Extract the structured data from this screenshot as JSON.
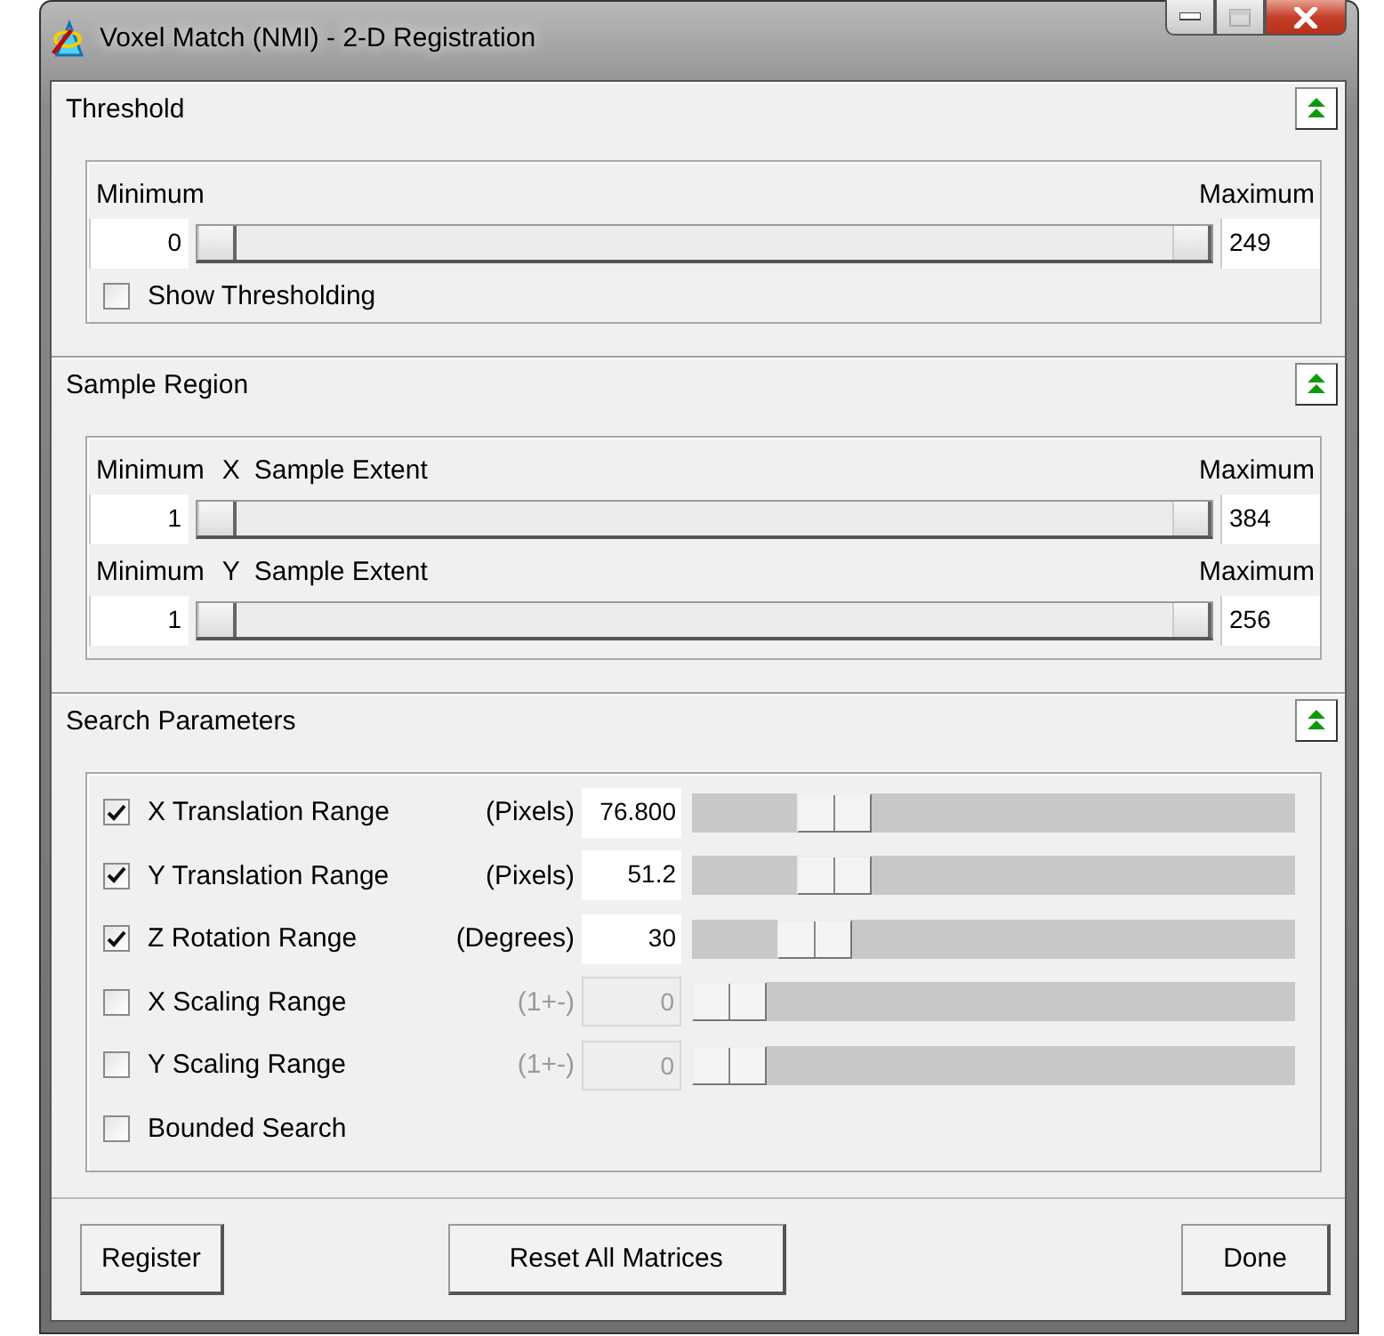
{
  "window": {
    "title": "Voxel Match (NMI) - 2-D Registration"
  },
  "sections": [
    {
      "title": "Threshold",
      "expanded": true,
      "ranges": [
        {
          "min_label": "Minimum",
          "max_label": "Maximum",
          "min_value": "0",
          "max_value": "249",
          "thumbs": [
            {
              "level": 0
            },
            {
              "level": 1
            }
          ]
        }
      ],
      "checkboxes": [
        {
          "label": "Show Thresholding",
          "checked": false
        }
      ]
    },
    {
      "title": "Sample Region",
      "expanded": true,
      "ranges": [
        {
          "min_label": "Minimum",
          "axis": "X",
          "caption": "Sample Extent",
          "max_label": "Maximum",
          "min_value": "1",
          "max_value": "384",
          "thumbs": [
            {
              "level": 0
            },
            {
              "level": 1
            }
          ]
        },
        {
          "min_label": "Minimum",
          "axis": "Y",
          "caption": "Sample Extent",
          "max_label": "Maximum",
          "min_value": "1",
          "max_value": "256",
          "thumbs": [
            {
              "level": 0
            },
            {
              "level": 1
            }
          ]
        }
      ]
    },
    {
      "title": "Search Parameters",
      "expanded": true,
      "parameters": [
        {
          "kind": "range",
          "label": "X Translation Range",
          "checked": true,
          "disabled": false,
          "unit": "(Pixels)",
          "value": "76.800",
          "level": 0.2
        },
        {
          "kind": "range",
          "label": "Y Translation Range",
          "checked": true,
          "disabled": false,
          "unit": "(Pixels)",
          "value": "51.2",
          "level": 0.2
        },
        {
          "kind": "range",
          "label": "Z Rotation Range",
          "checked": true,
          "disabled": false,
          "unit": "(Degrees)",
          "value": "30",
          "level": 0.16
        },
        {
          "kind": "range",
          "label": "X Scaling Range",
          "checked": false,
          "disabled": true,
          "unit": "(1+-)",
          "value": "0",
          "level": 0
        },
        {
          "kind": "range",
          "label": "Y Scaling Range",
          "checked": false,
          "disabled": true,
          "unit": "(1+-)",
          "value": "0",
          "level": 0
        },
        {
          "kind": "checkbox",
          "label": "Bounded Search",
          "checked": false
        }
      ]
    }
  ],
  "buttons": [
    "Register",
    "Reset All Matrices",
    "Done"
  ]
}
